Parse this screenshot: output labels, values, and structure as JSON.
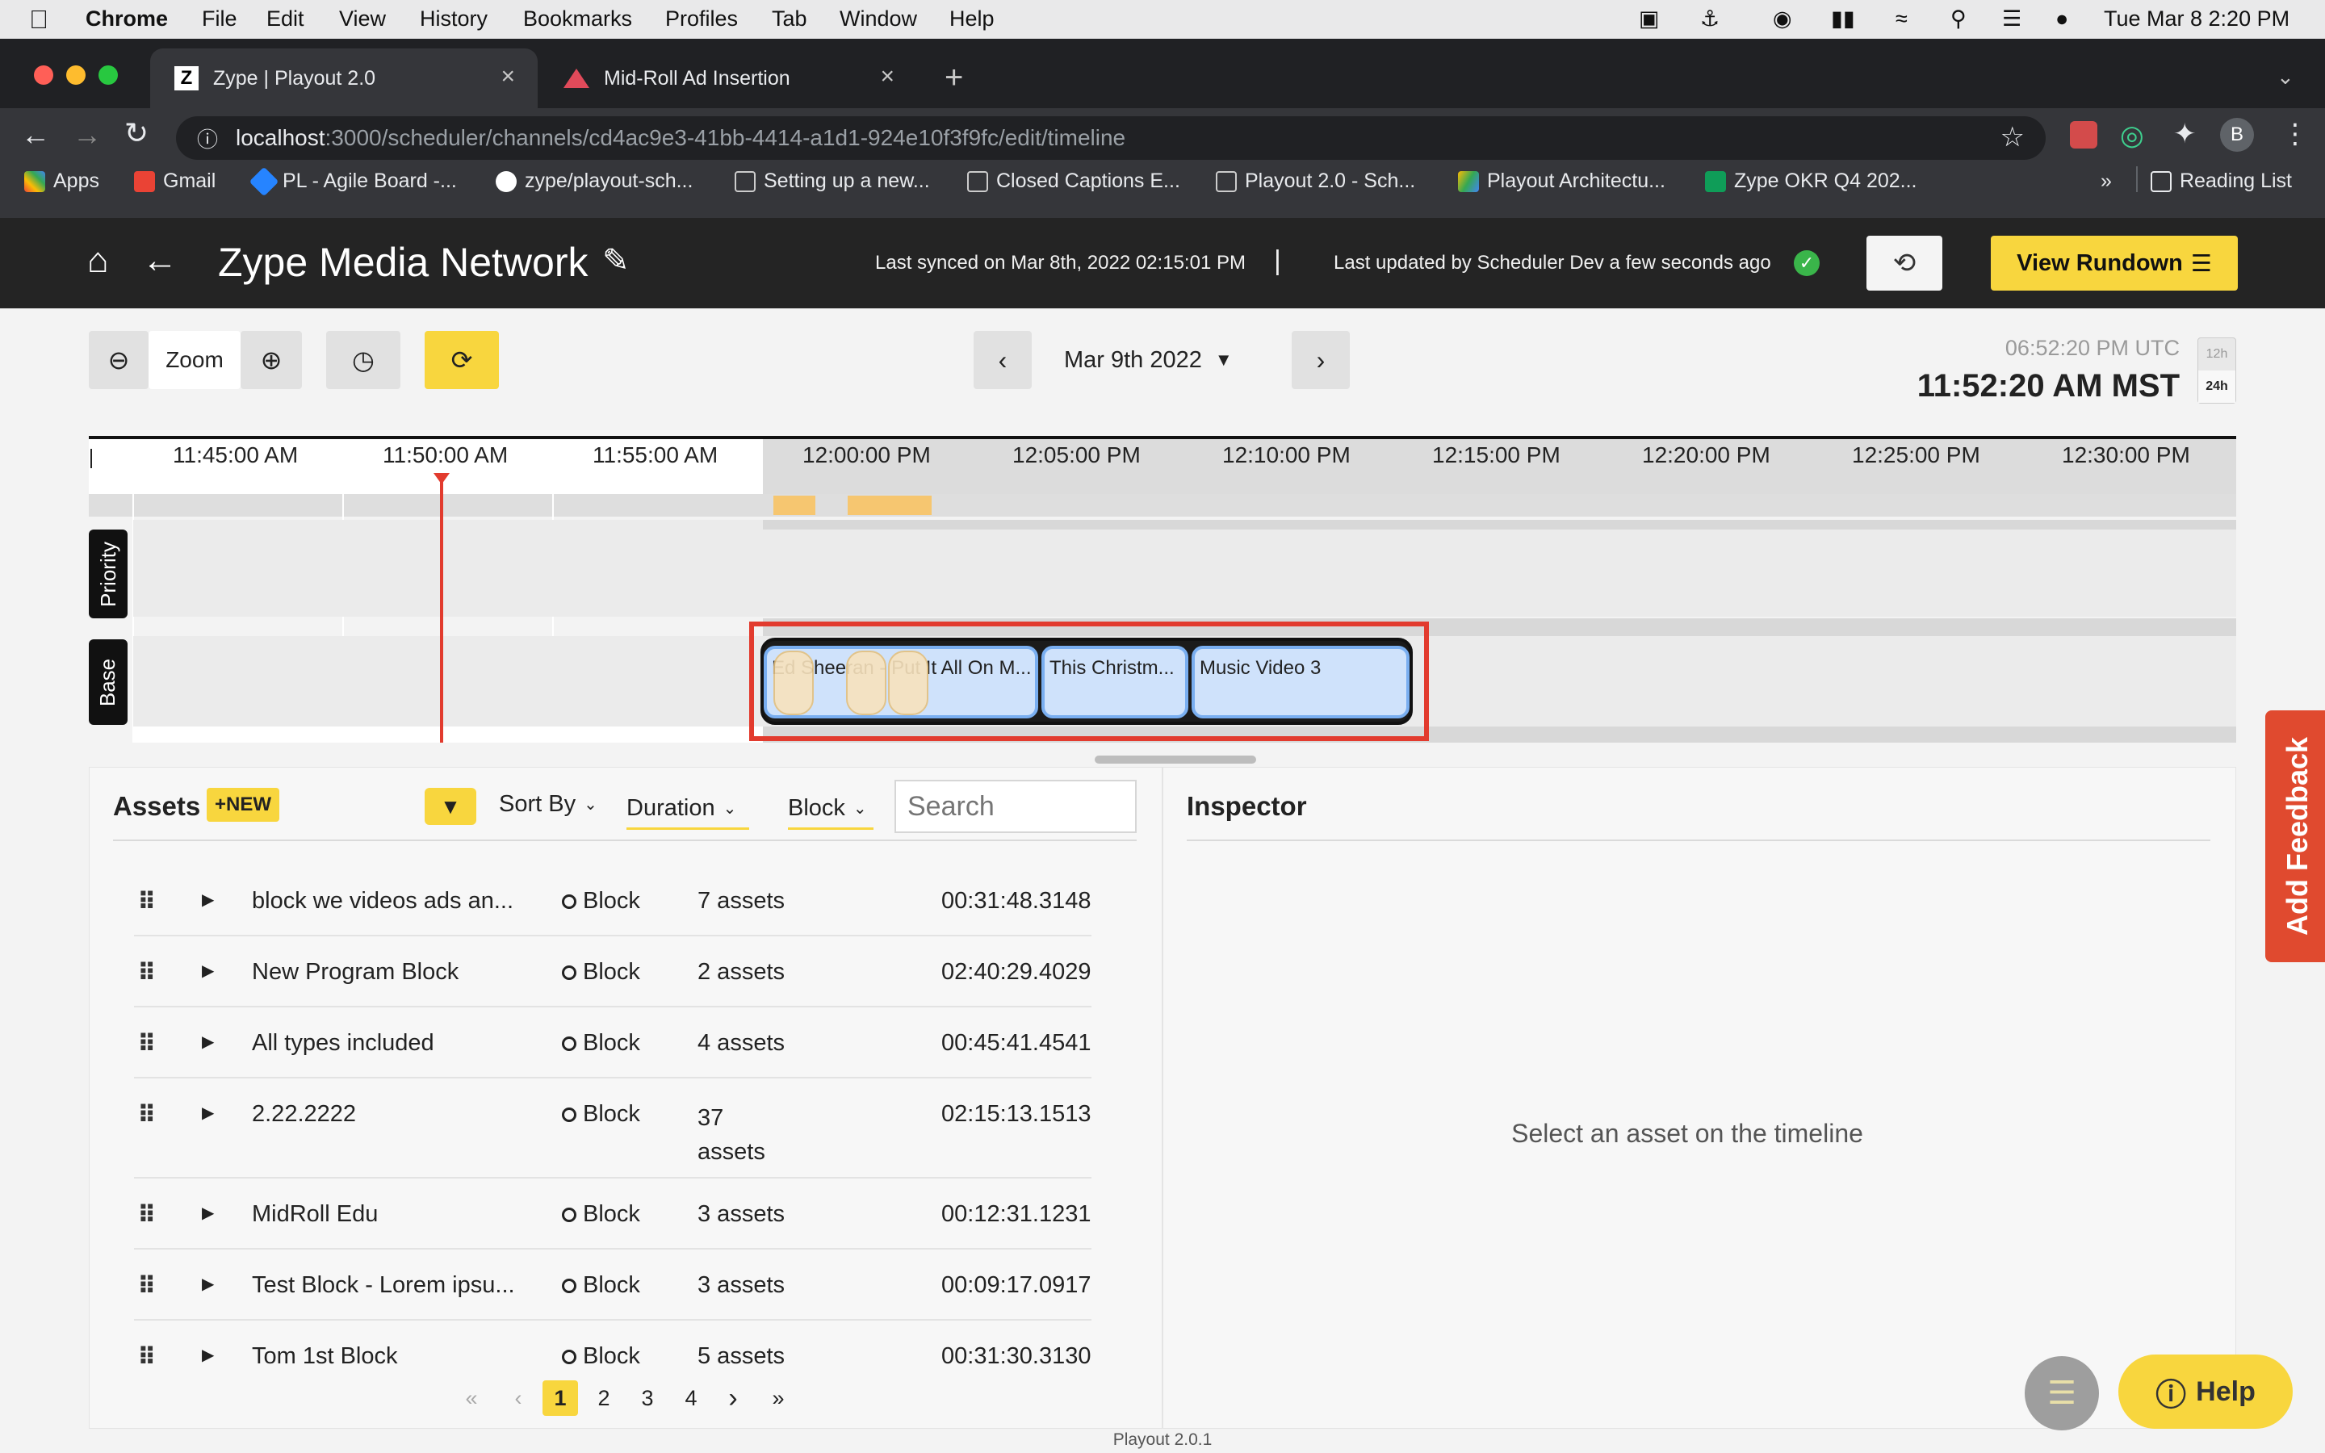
{
  "menubar": {
    "app": "Chrome",
    "items": [
      "File",
      "Edit",
      "View",
      "History",
      "Bookmarks",
      "Profiles",
      "Tab",
      "Window",
      "Help"
    ],
    "clock": "Tue Mar 8  2:20 PM"
  },
  "tabs": [
    {
      "label": "Zype | Playout 2.0",
      "icon": "zype-logo-icon"
    },
    {
      "label": "Mid-Roll Ad Insertion",
      "icon": "triangle-icon"
    }
  ],
  "address": {
    "host": "localhost",
    "path": ":3000/scheduler/channels/cd4ac9e3-41bb-4414-a1d1-924e10f3f9fc/edit/timeline"
  },
  "profile_initial": "B",
  "bookmarks": [
    {
      "label": "Apps"
    },
    {
      "label": "Gmail"
    },
    {
      "label": "PL - Agile Board -..."
    },
    {
      "label": "zype/playout-sch..."
    },
    {
      "label": "Setting up a new..."
    },
    {
      "label": "Closed Captions E..."
    },
    {
      "label": "Playout 2.0 - Sch..."
    },
    {
      "label": "Playout Architectu..."
    },
    {
      "label": "Zype OKR Q4 202..."
    }
  ],
  "bookmarks_overflow": "»",
  "reading_list": "Reading List",
  "header": {
    "title": "Zype Media Network",
    "last_synced": "Last synced on Mar 8th, 2022 02:15:01 PM",
    "separator": "|",
    "last_updated": "Last updated by Scheduler Dev a few seconds ago",
    "view_rundown": "View Rundown"
  },
  "controls": {
    "zoom_label": "Zoom",
    "date": "Mar 9th 2022",
    "utc_time": "06:52:20 PM UTC",
    "local_time": "11:52:20 AM MST",
    "format_12h": "12h",
    "format_24h": "24h"
  },
  "timeline": {
    "ticks": [
      "11:45:00 AM",
      "11:50:00 AM",
      "11:55:00 AM",
      "12:00:00 PM",
      "12:05:00 PM",
      "12:10:00 PM",
      "12:15:00 PM",
      "12:20:00 PM",
      "12:25:00 PM",
      "12:30:00 PM"
    ],
    "lanes": [
      "Priority",
      "Base"
    ],
    "clips": [
      "Ed Sheeran - Put It All On M...",
      "This Christm...",
      "Music Video 3"
    ]
  },
  "assets": {
    "title": "Assets",
    "new_badge": "+NEW",
    "sort_by": "Sort By",
    "duration_filter": "Duration",
    "block_filter": "Block",
    "search_placeholder": "Search",
    "rows": [
      {
        "name": "block we videos ads an...",
        "type": "Block",
        "count": "7 assets",
        "duration": "00:31:48.3148"
      },
      {
        "name": "New Program Block",
        "type": "Block",
        "count": "2 assets",
        "duration": "02:40:29.4029"
      },
      {
        "name": "All types included",
        "type": "Block",
        "count": "4 assets",
        "duration": "00:45:41.4541"
      },
      {
        "name": "2.22.2222",
        "type": "Block",
        "count": "37 assets",
        "duration": "02:15:13.1513"
      },
      {
        "name": "MidRoll Edu",
        "type": "Block",
        "count": "3 assets",
        "duration": "00:12:31.1231"
      },
      {
        "name": "Test Block - Lorem ipsu...",
        "type": "Block",
        "count": "3 assets",
        "duration": "00:09:17.0917"
      },
      {
        "name": "Tom 1st Block",
        "type": "Block",
        "count": "5 assets",
        "duration": "00:31:30.3130"
      }
    ],
    "pagination": {
      "first": "«",
      "prev": "‹",
      "pages": [
        "1",
        "2",
        "3",
        "4"
      ],
      "current": "1",
      "next": "›",
      "last": "»"
    }
  },
  "inspector": {
    "title": "Inspector",
    "empty_message": "Select an asset on the timeline"
  },
  "feedback": "Add Feedback",
  "help": "Help",
  "version": "Playout 2.0.1",
  "colors": {
    "accent_yellow": "#f8d63e",
    "clip_blue": "#cfe2fb",
    "playhead_red": "#e23b2e",
    "feedback_red": "#e04a2f"
  }
}
